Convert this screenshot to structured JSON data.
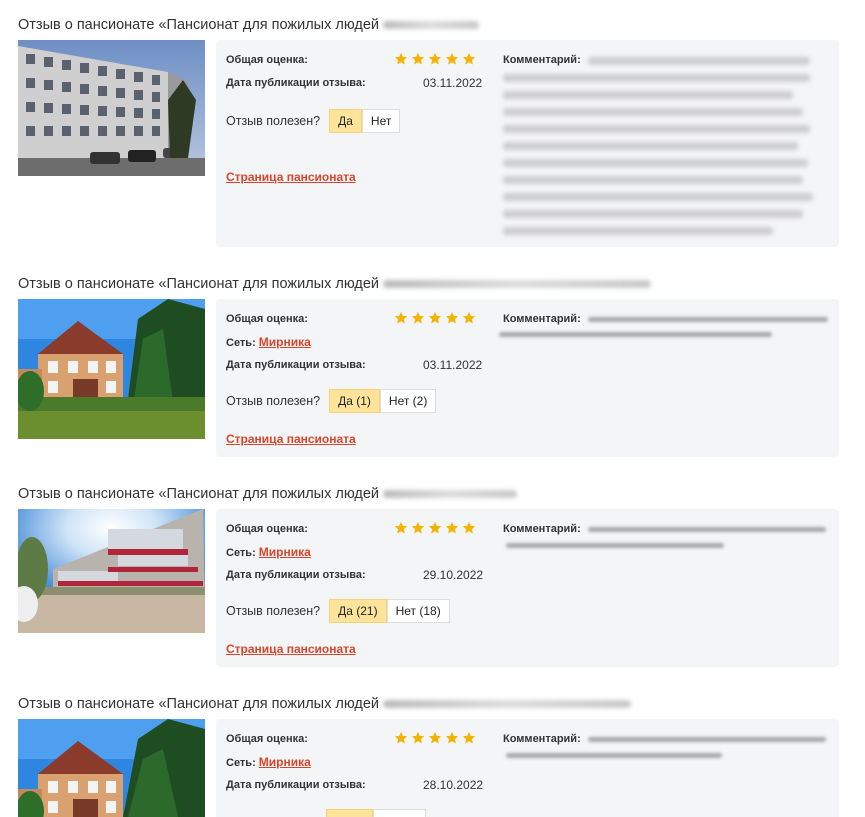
{
  "reviews": [
    {
      "title": "Отзыв о пансионате «Пансионат для пожилых людей",
      "rating_label": "Общая оценка:",
      "rating": 5,
      "network_label": "",
      "network_name": "",
      "date_label": "Дата публикации отзыва:",
      "date": "03.11.2022",
      "useful_label": "Отзыв полезен?",
      "yes_label": "Да",
      "no_label": "Нет",
      "page_link": "Страница пансионата",
      "comment_label": "Комментарий:"
    },
    {
      "title": "Отзыв о пансионате «Пансионат для пожилых людей",
      "rating_label": "Общая оценка:",
      "rating": 5,
      "network_label": "Сеть:",
      "network_name": "Мирника",
      "date_label": "Дата публикации отзыва:",
      "date": "03.11.2022",
      "useful_label": "Отзыв полезен?",
      "yes_label": "Да (1)",
      "no_label": "Нет (2)",
      "page_link": "Страница пансионата",
      "comment_label": "Комментарий:"
    },
    {
      "title": "Отзыв о пансионате «Пансионат для пожилых людей",
      "rating_label": "Общая оценка:",
      "rating": 5,
      "network_label": "Сеть:",
      "network_name": "Мирника",
      "date_label": "Дата публикации отзыва:",
      "date": "29.10.2022",
      "useful_label": "Отзыв полезен?",
      "yes_label": "Да (21)",
      "no_label": "Нет (18)",
      "page_link": "Страница пансионата",
      "comment_label": "Комментарий:"
    },
    {
      "title": "Отзыв о пансионате «Пансионат для пожилых людей",
      "rating_label": "Общая оценка:",
      "rating": 5,
      "network_label": "Сеть:",
      "network_name": "Мирника",
      "date_label": "Дата публикации отзыва:",
      "date": "28.10.2022",
      "useful_label": "",
      "yes_label": "",
      "no_label": "",
      "page_link": "",
      "comment_label": "Комментарий:"
    }
  ],
  "colors": {
    "link": "#d9452b",
    "star": "#f5b301",
    "yes_button": "#fde49a",
    "card_bg": "#f4f5f7"
  },
  "icons": {
    "star": "star-icon"
  }
}
